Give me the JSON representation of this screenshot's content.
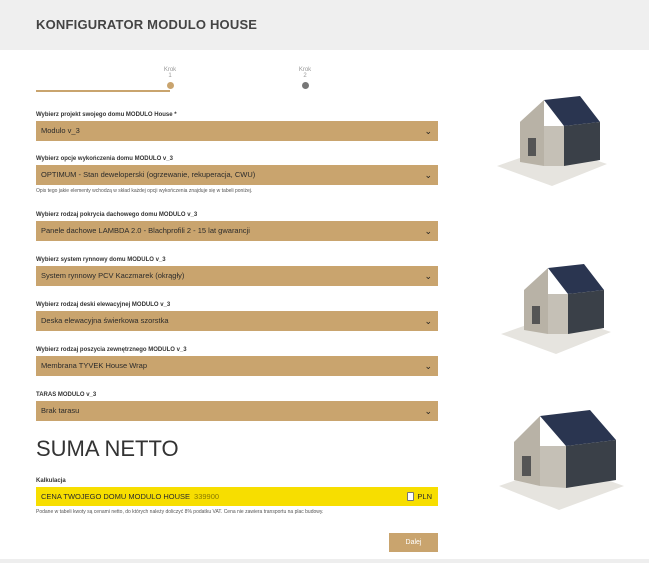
{
  "header": {
    "title": "KONFIGURATOR MODULO HOUSE"
  },
  "stepper": {
    "steps": [
      {
        "label": "Krok",
        "number": "1"
      },
      {
        "label": "Krok",
        "number": "2"
      }
    ],
    "current_step": 1
  },
  "fields": {
    "project": {
      "label": "Wybierz projekt swojego domu MODULO House *",
      "value": "Modulo v_3"
    },
    "finish": {
      "label": "Wybierz opcje wykończenia domu MODULO v_3",
      "value": "OPTIMUM - Stan deweloperski (ogrzewanie, rekuperacja, CWU)",
      "help": "Opis tego jakie elementy wchodzą w skład każdej opcji wykończenia znajduje się w tabeli poniżej."
    },
    "roof": {
      "label": "Wybierz rodzaj pokrycia dachowego domu MODULO v_3",
      "value": "Panele dachowe LAMBDA 2.0 - Blachprofili 2 - 15 lat gwarancji"
    },
    "gutter": {
      "label": "Wybierz system rynnowy domu MODULO v_3",
      "value": "System rynnowy PCV Kaczmarek (okrągły)"
    },
    "facade": {
      "label": "Wybierz rodzaj deski elewacyjnej MODULO v_3",
      "value": "Deska elewacyjna świerkowa szorstka"
    },
    "membrane": {
      "label": "Wybierz rodzaj poszycia zewnętrznego MODULO v_3",
      "value": "Membrana TYVEK House Wrap"
    },
    "terrace": {
      "label": "TARAS MODULO v_3",
      "value": "Brak tarasu"
    }
  },
  "summary": {
    "title": "SUMA NETTO",
    "calc_label": "Kalkulacja",
    "price_label": "CENA TWOJEGO DOMU MODULO HOUSE",
    "price_value": "339900",
    "currency": "PLN",
    "note": "Podane w tabeli kwoty są cenami netto, do których należy doliczyć 8% podatku VAT. Cena nie zawiera transportu na plac budowy."
  },
  "actions": {
    "next_label": "Dalej"
  },
  "colors": {
    "accent": "#c9a46e",
    "price_bg": "#f7de00",
    "header_bg": "#efefef"
  },
  "icons": [
    "chevron-down-icon",
    "calculator-icon"
  ]
}
